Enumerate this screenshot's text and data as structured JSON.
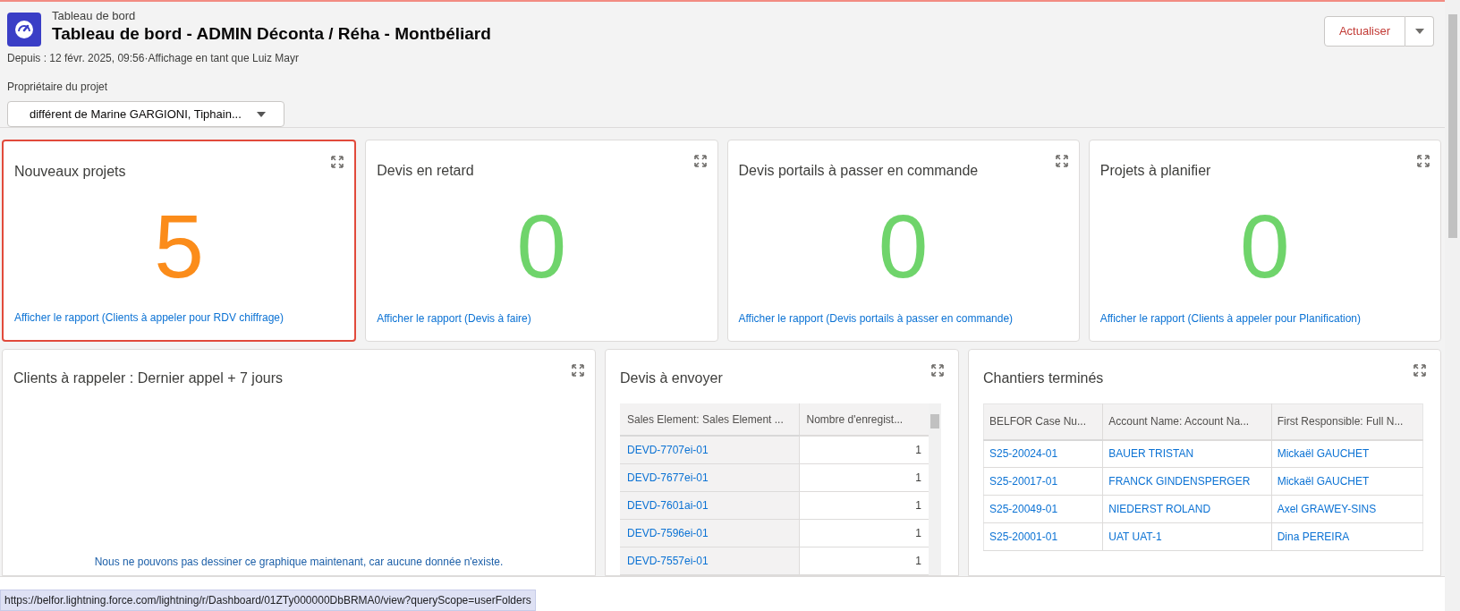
{
  "header": {
    "breadcrumb": "Tableau de bord",
    "title": "Tableau de bord - ADMIN Déconta / Réha - Montbéliard",
    "subtitle": "Depuis : 12 févr. 2025, 09:56·Affichage en tant que Luiz Mayr",
    "refresh_button": "Actualiser"
  },
  "filter": {
    "label": "Propriétaire du projet",
    "value": "différent de Marine GARGIONI, Tiphain..."
  },
  "metrics": [
    {
      "title": "Nouveaux projets",
      "value": "5",
      "color": "#fb8c1a",
      "link": "Afficher le rapport (Clients à appeler pour RDV chiffrage)",
      "selected": true
    },
    {
      "title": "Devis en retard",
      "value": "0",
      "color": "#6fd46b",
      "link": "Afficher le rapport (Devis à faire)",
      "selected": false
    },
    {
      "title": "Devis portails à passer en commande",
      "value": "0",
      "color": "#6fd46b",
      "link": "Afficher le rapport (Devis portails à passer en commande)",
      "selected": false
    },
    {
      "title": "Projets à planifier",
      "value": "0",
      "color": "#6fd46b",
      "link": "Afficher le rapport (Clients à appeler pour Planification)",
      "selected": false
    }
  ],
  "chart_panel": {
    "title": "Clients à rappeler : Dernier appel + 7 jours",
    "message": "Nous ne pouvons pas dessiner ce graphique maintenant, car aucune donnée n'existe."
  },
  "devis_table": {
    "title": "Devis à envoyer",
    "columns": [
      "Sales Element: Sales Element ...",
      "Nombre d'enregist..."
    ],
    "rows": [
      [
        "DEVD-7707ei-01",
        "1"
      ],
      [
        "DEVD-7677ei-01",
        "1"
      ],
      [
        "DEVD-7601ai-01",
        "1"
      ],
      [
        "DEVD-7596ei-01",
        "1"
      ],
      [
        "DEVD-7557ei-01",
        "1"
      ]
    ]
  },
  "chantiers_table": {
    "title": "Chantiers terminés",
    "columns": [
      "BELFOR Case Nu...",
      "Account Name: Account Na...",
      "First Responsible: Full N..."
    ],
    "rows": [
      [
        "S25-20024-01",
        "BAUER TRISTAN",
        "Mickaël GAUCHET"
      ],
      [
        "S25-20017-01",
        "FRANCK GINDENSPERGER",
        "Mickaël GAUCHET"
      ],
      [
        "S25-20049-01",
        "NIEDERST ROLAND",
        "Axel GRAWEY-SINS"
      ],
      [
        "S25-20001-01",
        "UAT UAT-1",
        "Dina PEREIRA"
      ]
    ]
  },
  "status_url": "https://belfor.lightning.force.com/lightning/r/Dashboard/01ZTy000000DbBRMA0/view?queryScope=userFolders"
}
